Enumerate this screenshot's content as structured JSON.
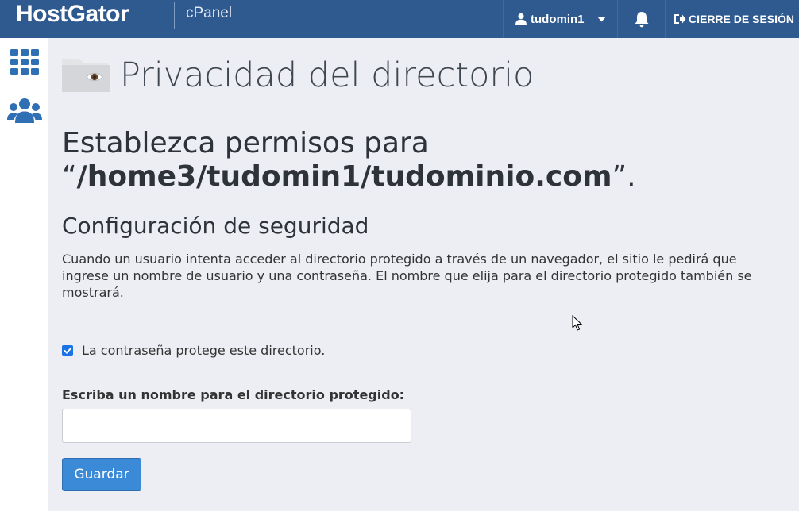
{
  "header": {
    "logo_text": "HostGator",
    "product_label": "cPanel",
    "username": "tudomin1",
    "logout_label": "CIERRE DE SESIÓN"
  },
  "sidebar": {
    "items": [
      {
        "icon": "grid-icon"
      },
      {
        "icon": "users-icon"
      }
    ]
  },
  "page": {
    "title": "Privacidad del directorio",
    "permissions_prefix": "Establezca permisos para",
    "open_quote": "“",
    "path": "/home3/tudomin1/tudominio.com",
    "close_quote": "”.",
    "security_heading": "Configuración de seguridad",
    "security_description": "Cuando un usuario intenta acceder al directorio protegido a través de un navegador, el sitio le pedirá que ingrese un nombre de usuario y una contraseña. El nombre que elija para el directorio protegido también se mostrará.",
    "protect_checkbox_label": "La contraseña protege este directorio.",
    "protect_checked": true,
    "dir_name_label": "Escriba un nombre para el directorio protegido:",
    "dir_name_value": "",
    "save_label": "Guardar"
  },
  "colors": {
    "topbar": "#2f5a8f",
    "button": "#3b8ad8",
    "sidebar_icon": "#2f6fb4"
  }
}
